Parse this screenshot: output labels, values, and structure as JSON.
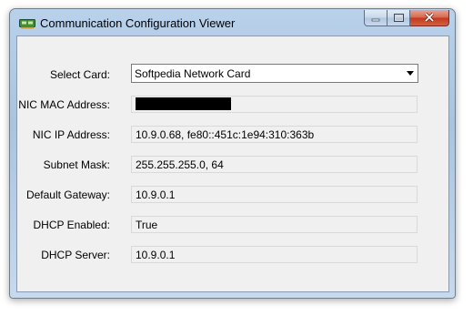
{
  "window": {
    "title": "Communication Configuration Viewer",
    "icon": "network-card-icon",
    "buttons": [
      "minimize-icon",
      "maximize-icon",
      "close-icon"
    ]
  },
  "form": {
    "select_card": {
      "label": "Select Card:",
      "value": "Softpedia Network Card"
    },
    "mac": {
      "label": "NIC MAC Address:",
      "value": ""
    },
    "ip": {
      "label": "NIC IP Address:",
      "value": "10.9.0.68, fe80::451c:1e94:310:363b"
    },
    "subnet": {
      "label": "Subnet Mask:",
      "value": "255.255.255.0, 64"
    },
    "gateway": {
      "label": "Default Gateway:",
      "value": "10.9.0.1"
    },
    "dhcp_enabled": {
      "label": "DHCP Enabled:",
      "value": "True"
    },
    "dhcp_server": {
      "label": "DHCP Server:",
      "value": "10.9.0.1"
    }
  },
  "colors": {
    "frame": "#b9d1ea",
    "client_bg": "#f0f0f0",
    "close_button": "#c2381b"
  }
}
